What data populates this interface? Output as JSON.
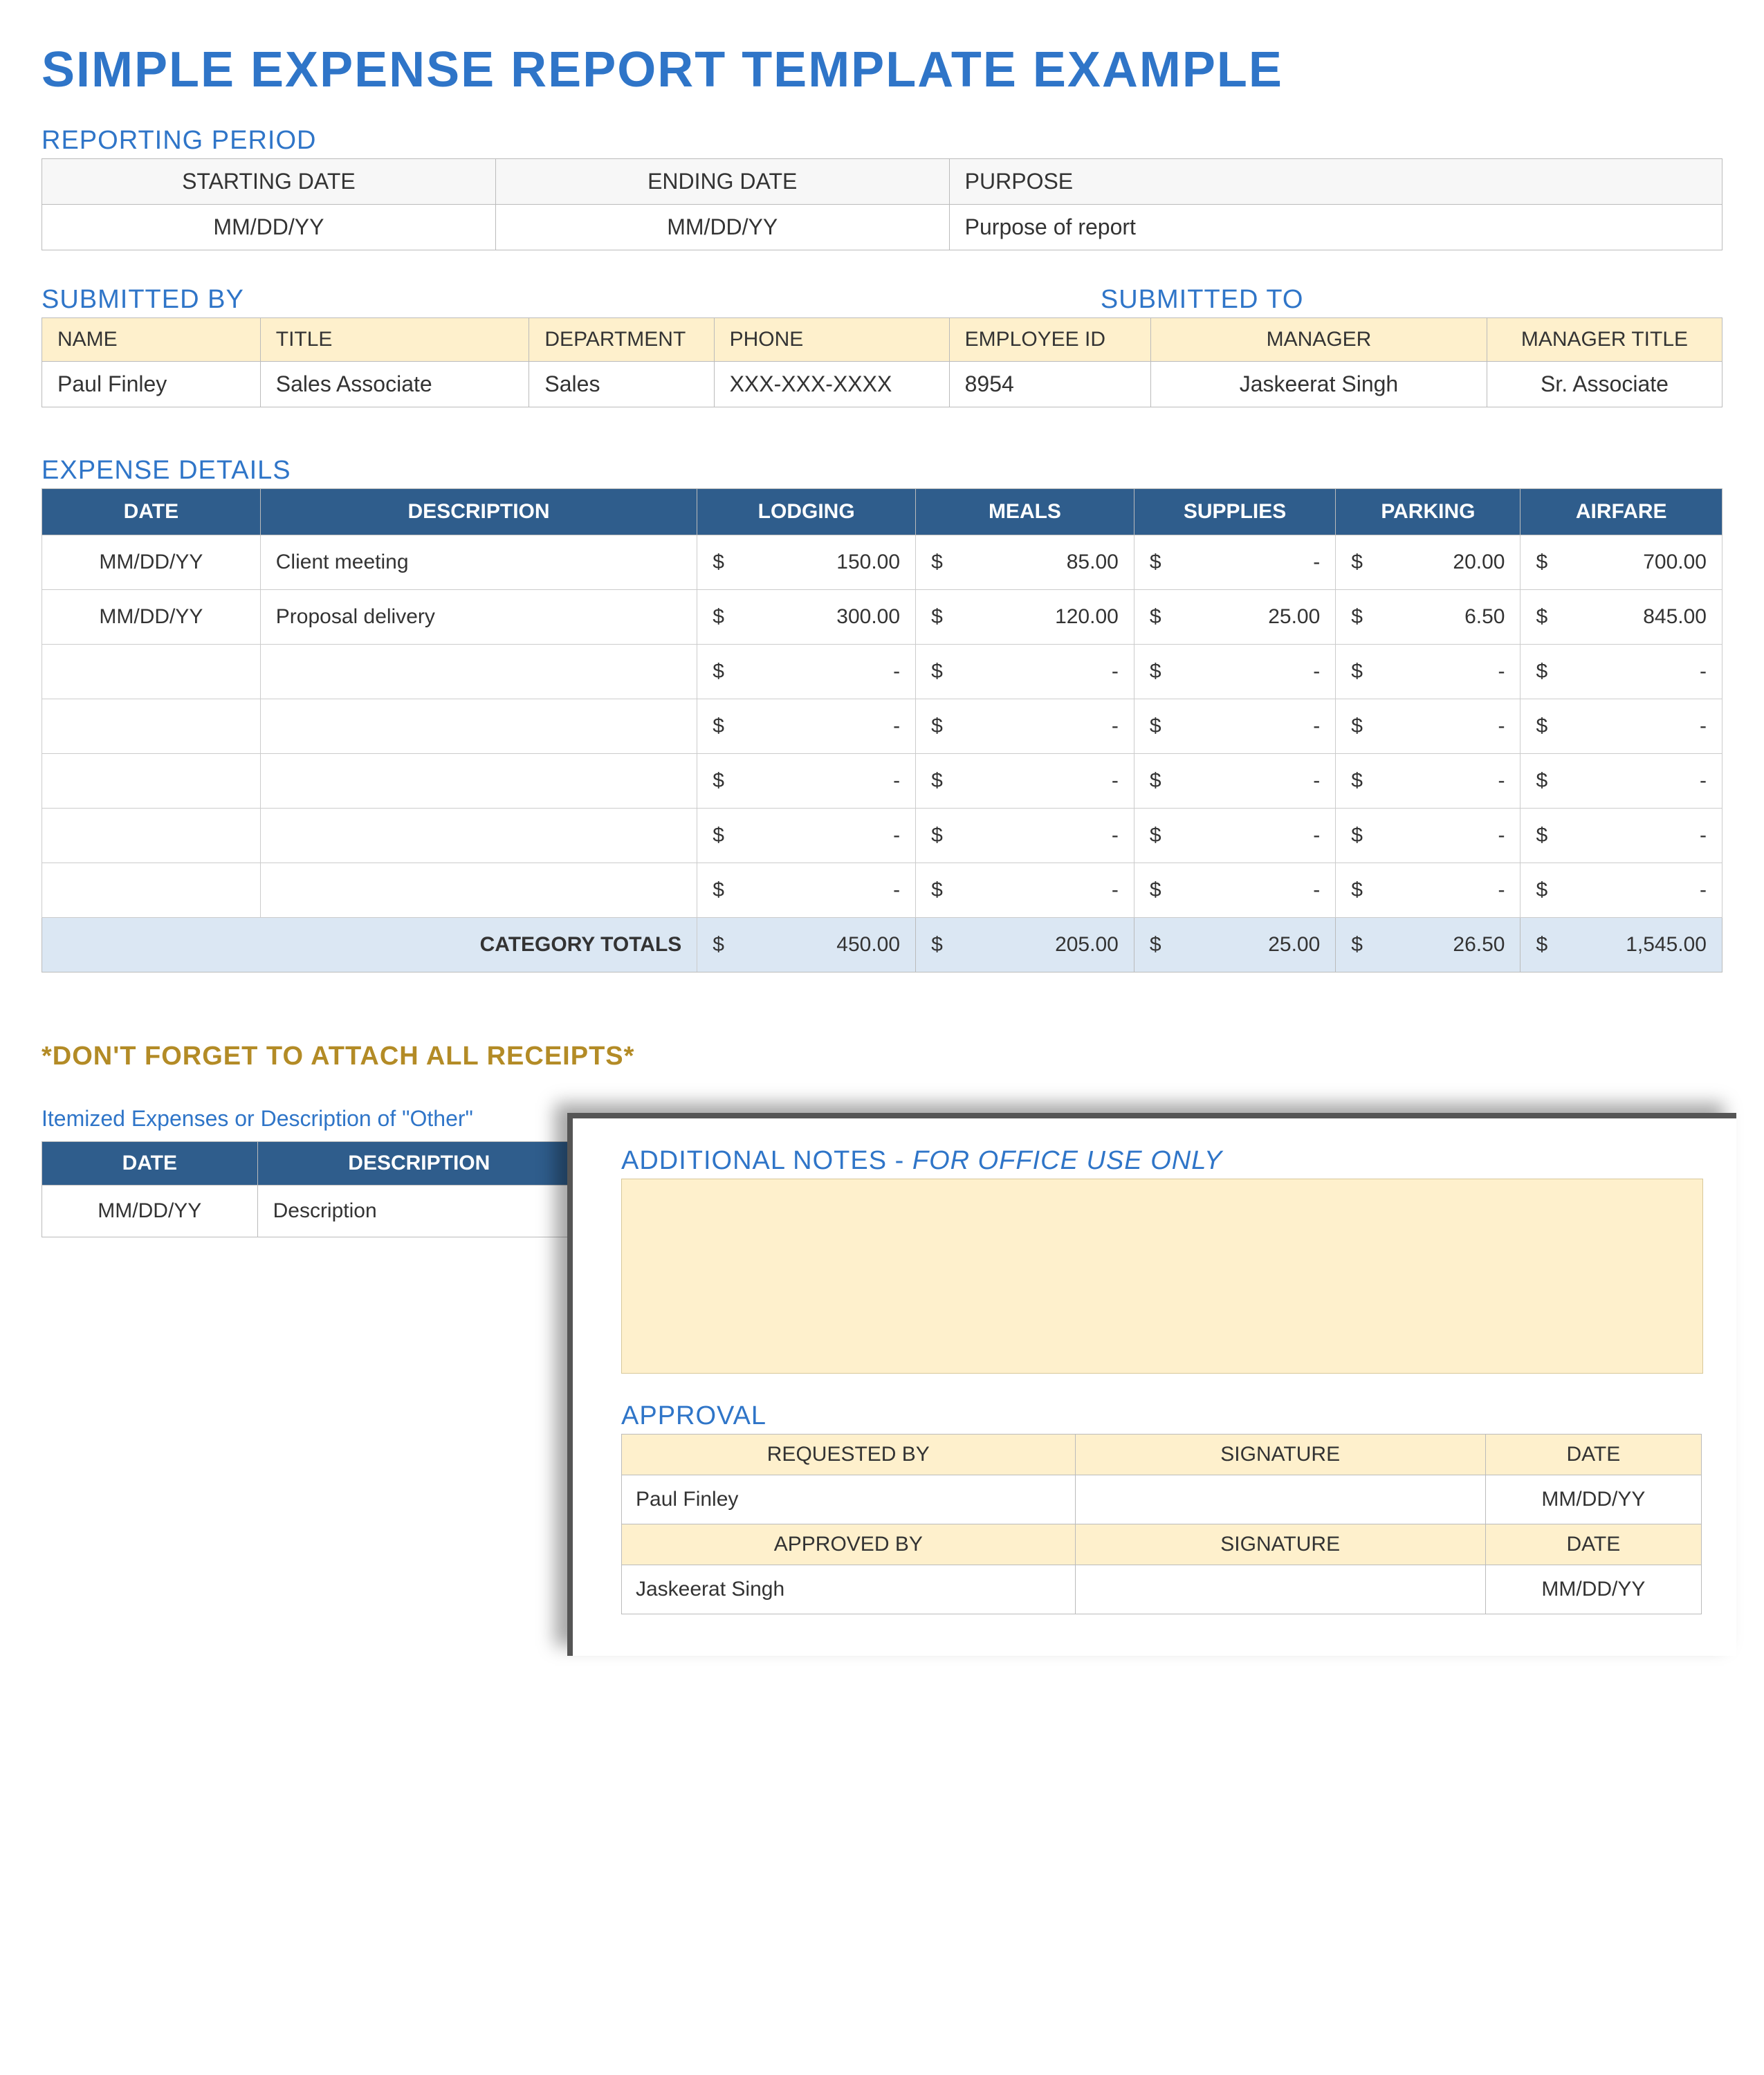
{
  "title": "SIMPLE EXPENSE REPORT TEMPLATE EXAMPLE",
  "reporting_period": {
    "heading": "REPORTING PERIOD",
    "cols": [
      "STARTING DATE",
      "ENDING DATE",
      "PURPOSE"
    ],
    "vals": [
      "MM/DD/YY",
      "MM/DD/YY",
      "Purpose of report"
    ]
  },
  "submitted": {
    "by_heading": "SUBMITTED BY",
    "to_heading": "SUBMITTED TO",
    "cols_by": [
      "NAME",
      "TITLE",
      "DEPARTMENT",
      "PHONE",
      "EMPLOYEE ID"
    ],
    "cols_to": [
      "MANAGER",
      "MANAGER TITLE"
    ],
    "vals_by": [
      "Paul Finley",
      "Sales Associate",
      "Sales",
      "XXX-XXX-XXXX",
      "8954"
    ],
    "vals_to": [
      "Jaskeerat Singh",
      "Sr. Associate"
    ]
  },
  "expense": {
    "heading": "EXPENSE DETAILS",
    "cols": [
      "DATE",
      "DESCRIPTION",
      "LODGING",
      "MEALS",
      "SUPPLIES",
      "PARKING",
      "AIRFARE"
    ],
    "rows": [
      {
        "date": "MM/DD/YY",
        "desc": "Client meeting",
        "vals": [
          "150.00",
          "85.00",
          "-",
          "20.00",
          "700.00"
        ]
      },
      {
        "date": "MM/DD/YY",
        "desc": "Proposal delivery",
        "vals": [
          "300.00",
          "120.00",
          "25.00",
          "6.50",
          "845.00"
        ]
      },
      {
        "date": "",
        "desc": "",
        "vals": [
          "-",
          "-",
          "-",
          "-",
          "-"
        ]
      },
      {
        "date": "",
        "desc": "",
        "vals": [
          "-",
          "-",
          "-",
          "-",
          "-"
        ]
      },
      {
        "date": "",
        "desc": "",
        "vals": [
          "-",
          "-",
          "-",
          "-",
          "-"
        ]
      },
      {
        "date": "",
        "desc": "",
        "vals": [
          "-",
          "-",
          "-",
          "-",
          "-"
        ]
      },
      {
        "date": "",
        "desc": "",
        "vals": [
          "-",
          "-",
          "-",
          "-",
          "-"
        ]
      }
    ],
    "totals_label": "CATEGORY TOTALS",
    "totals": [
      "450.00",
      "205.00",
      "25.00",
      "26.50",
      "1,545.00"
    ]
  },
  "currency_symbol": "$",
  "receipts_note": "*DON'T FORGET TO ATTACH ALL RECEIPTS*",
  "itemized": {
    "heading": "Itemized Expenses or Description of \"Other\"",
    "cols": [
      "DATE",
      "DESCRIPTION"
    ],
    "row": {
      "date": "MM/DD/YY",
      "desc": "Description"
    }
  },
  "notes": {
    "heading_a": "ADDITIONAL NOTES - ",
    "heading_b": "FOR OFFICE USE ONLY"
  },
  "approval": {
    "heading": "APPROVAL",
    "row1_cols": [
      "REQUESTED BY",
      "SIGNATURE",
      "DATE"
    ],
    "row1_vals": [
      "Paul Finley",
      "",
      "MM/DD/YY"
    ],
    "row2_cols": [
      "APPROVED BY",
      "SIGNATURE",
      "DATE"
    ],
    "row2_vals": [
      "Jaskeerat Singh",
      "",
      "MM/DD/YY"
    ]
  }
}
